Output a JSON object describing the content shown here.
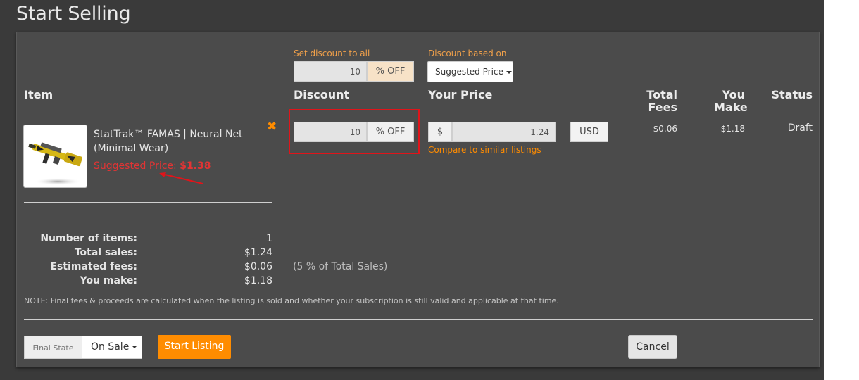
{
  "page": {
    "title": "Start Selling"
  },
  "bulk": {
    "set_discount_label": "Set discount to all",
    "discount_value": "10",
    "discount_suffix": "% OFF",
    "based_on_label": "Discount based on",
    "based_on_value": "Suggested Price"
  },
  "columns": {
    "item": "Item",
    "discount": "Discount",
    "your_price": "Your Price",
    "total_fees": "Total Fees",
    "you_make": "You Make",
    "status": "Status"
  },
  "item": {
    "name": "StatTrak™ FAMAS | Neural Net (Minimal Wear)",
    "suggested_label": "Suggested Price:",
    "suggested_value": "$1.38",
    "discount_value": "10",
    "discount_suffix": "% OFF",
    "currency_symbol": "$",
    "price_value": "1.24",
    "currency": "USD",
    "compare_link": "Compare to similar listings",
    "total_fees": "$0.06",
    "you_make": "$1.18",
    "status": "Draft",
    "remove_icon": "close-icon"
  },
  "summary": {
    "rows": [
      {
        "label": "Number of items:",
        "value": "1"
      },
      {
        "label": "Total sales:",
        "value": "$1.24"
      },
      {
        "label": "Estimated fees:",
        "value": "$0.06"
      },
      {
        "label": "You make:",
        "value": "$1.18"
      }
    ],
    "fee_note": "(5 % of Total Sales)",
    "note": "NOTE: Final fees & proceeds are calculated when the listing is sold and whether your subscription is still valid and applicable at that time."
  },
  "footer": {
    "final_state_label": "Final State",
    "final_state_value": "On Sale",
    "start_button": "Start Listing",
    "cancel_button": "Cancel"
  },
  "colors": {
    "accent_orange": "#ff8c00",
    "annotation_red": "#e0141a",
    "panel_bg": "#4b4b4b",
    "page_bg": "#3a3a3a"
  }
}
